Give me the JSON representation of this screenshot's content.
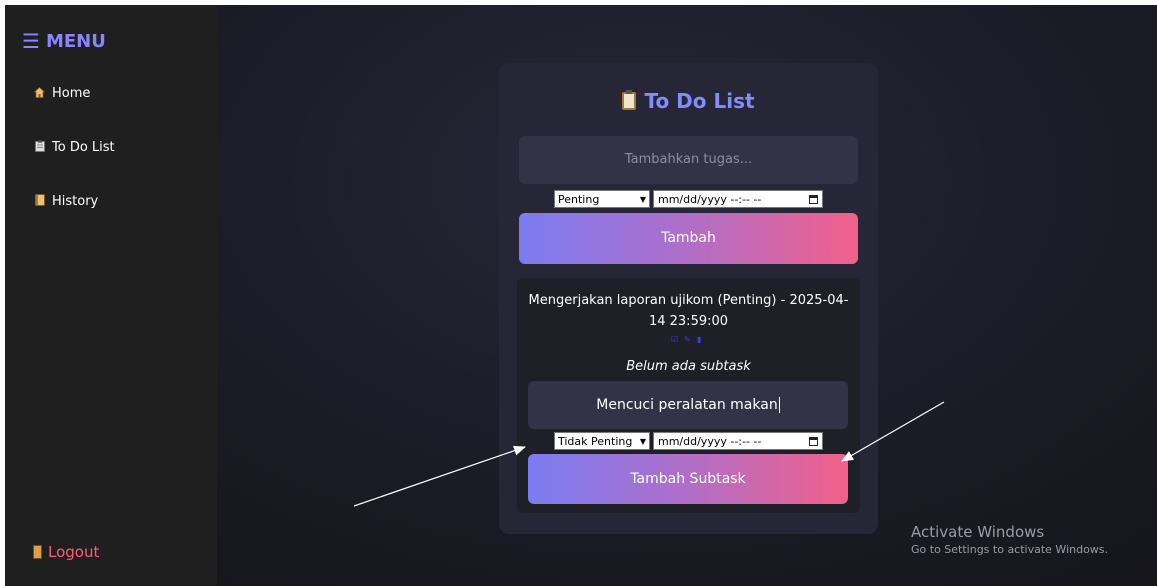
{
  "sidebar": {
    "title": "MENU",
    "items": [
      {
        "label": "Home",
        "icon": "house-icon"
      },
      {
        "label": "To Do List",
        "icon": "clipboard-icon"
      },
      {
        "label": "History",
        "icon": "scroll-icon"
      }
    ],
    "logout_label": "Logout"
  },
  "card": {
    "title": "To Do List",
    "task_input_placeholder": "Tambahkan tugas...",
    "priority_selected": "Penting",
    "date_placeholder": "mm/dd/yyyy --:-- --",
    "add_button": "Tambah"
  },
  "task": {
    "text": "Mengerjakan laporan ujikom (Penting) - 2025-04-14 23:59:00",
    "no_subtask_label": "Belum ada subtask",
    "subtask_input_value": "Mencuci peralatan makan",
    "subtask_priority_selected": "Tidak Penting",
    "subtask_date_placeholder": "mm/dd/yyyy --:-- --",
    "add_subtask_button": "Tambah Subtask"
  },
  "watermark": {
    "line1": "Activate Windows",
    "line2": "Go to Settings to activate Windows."
  },
  "colors": {
    "accent": "#7f8dff",
    "logout": "#ff5c7a",
    "gradient_start": "#7b7cf2",
    "gradient_end": "#f2608a"
  }
}
